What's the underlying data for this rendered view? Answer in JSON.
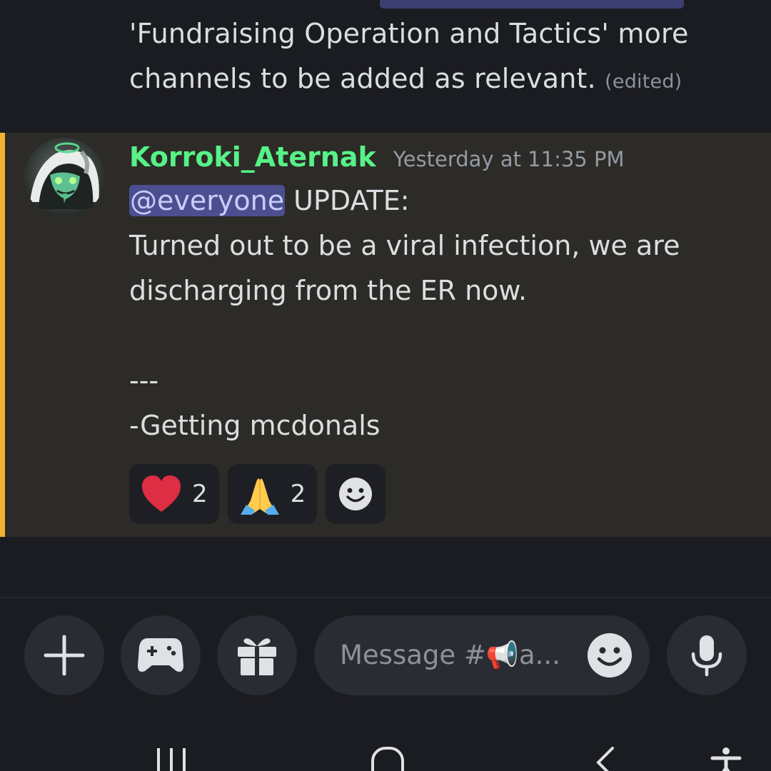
{
  "previous_message": {
    "line1": "'Fundraising Operation and Tactics' more",
    "line2": "channels to be added as relevant.",
    "edited_label": "(edited)"
  },
  "message": {
    "username": "Korroki_Aternak",
    "timestamp": "Yesterday at 11:35 PM",
    "mention": "@everyone",
    "line1_rest": " UPDATE:",
    "line2": "Turned out to be a viral infection, we are",
    "line3": "discharging from the ER now.",
    "line4": "",
    "line5": "---",
    "line6": "-Getting mcdonals",
    "reactions": [
      {
        "icon": "heart-emoji",
        "count": "2"
      },
      {
        "icon": "folded-hands-emoji",
        "count": "2"
      }
    ],
    "add_reaction_icon": "add-reaction-icon"
  },
  "composer": {
    "placeholder": "Message #📢a...",
    "buttons": [
      "plus-icon",
      "gamepad-icon",
      "gift-icon",
      "emoji-icon",
      "microphone-icon"
    ]
  },
  "nav_bar": {
    "buttons": [
      "recents-icon",
      "home-icon",
      "back-icon",
      "accessibility-icon"
    ]
  },
  "colors": {
    "background": "#1b1c21",
    "highlight_background": "#2d2b27",
    "highlight_bar": "#f0b232",
    "username": "#57f287",
    "mention_bg": "#4c4f8f"
  }
}
